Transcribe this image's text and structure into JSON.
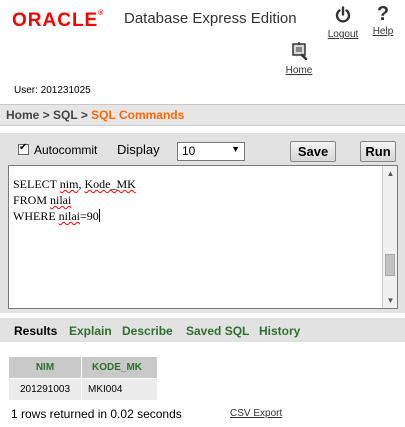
{
  "header": {
    "brand": "ORACLE",
    "product": "Database Express Edition",
    "logout_label": "Logout",
    "help_label": "Help",
    "home_label": "Home",
    "user_text": "User: 201231025"
  },
  "breadcrumb": {
    "home": "Home",
    "sep1": " > ",
    "sql": "SQL",
    "sep2": " > ",
    "current": "SQL Commands"
  },
  "toolbar": {
    "autocommit_label": "Autocommit",
    "autocommit_checked": true,
    "display_label": "Display",
    "display_value": "10",
    "save_label": "Save",
    "run_label": "Run"
  },
  "editor": {
    "line1_a": "SELECT ",
    "line1_b": "nim",
    "line1_c": ", ",
    "line1_d": "Kode_MK",
    "line2_a": "FROM ",
    "line2_b": "nilai",
    "line3_a": "WHERE ",
    "line3_b": "nilai",
    "line3_c": "=90"
  },
  "result_tabs": {
    "results": "Results",
    "explain": "Explain",
    "describe": "Describe",
    "saved_sql": "Saved SQL",
    "history": "History",
    "active": "Results"
  },
  "results": {
    "columns": [
      "NIM",
      "KODE_MK"
    ],
    "rows": [
      [
        "201291003",
        "MKI004"
      ]
    ],
    "status": "1 rows returned in 0.02 seconds",
    "csv_label": "CSV Export"
  },
  "colors": {
    "brand_red": "#ff0000",
    "crumb_current": "#ff6600",
    "tab_green": "#2f6f2f"
  }
}
